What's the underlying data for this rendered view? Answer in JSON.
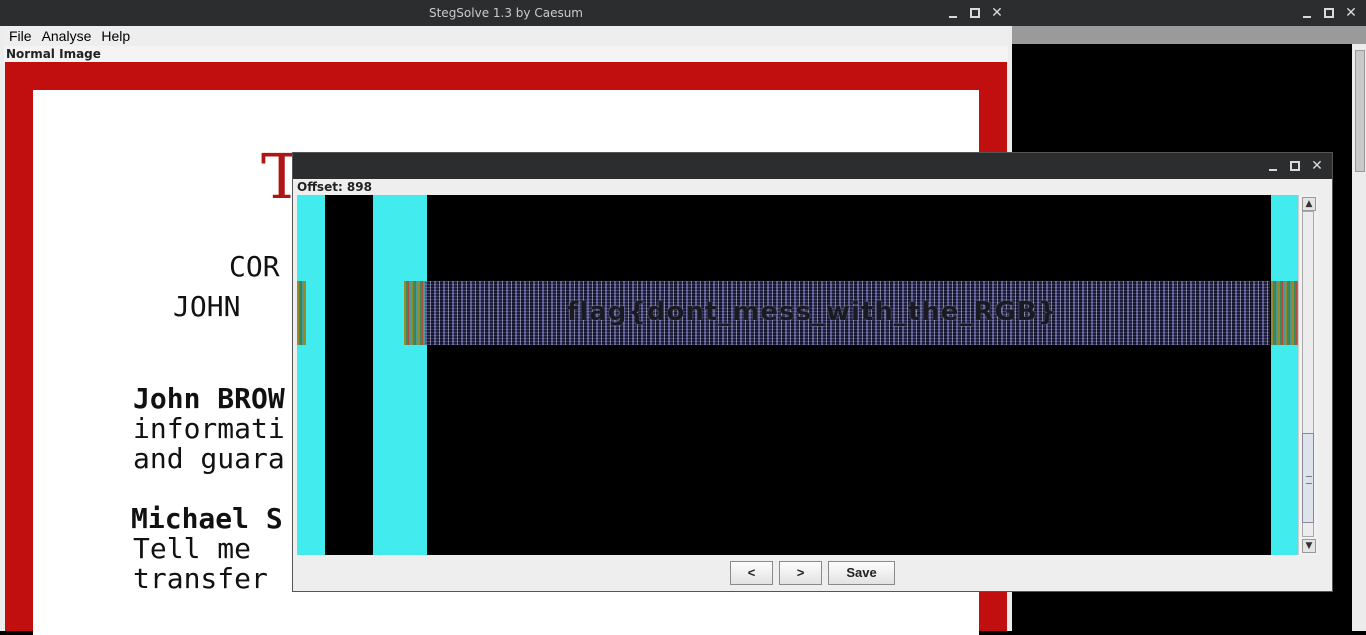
{
  "main_window": {
    "title": "StegSolve 1.3 by Caesum",
    "menu": [
      "File",
      "Analyse",
      "Help"
    ],
    "view_label": "Normal Image",
    "document": {
      "heading_letter": "T",
      "lines": [
        "COR",
        "JOHN",
        "John BROW",
        "informati",
        "and guara",
        "Michael S",
        "Tell me",
        "transfer"
      ]
    }
  },
  "dialog": {
    "offset_label": "Offset: 898",
    "hidden_text": "flag{dont_mess_with_the_RGB}",
    "buttons": {
      "prev": "<",
      "next": ">",
      "save": "Save"
    }
  },
  "window_controls": {
    "minimize": "minimize-icon",
    "maximize": "maximize-icon",
    "close": "close-icon",
    "close_glyph": "✕"
  },
  "colors": {
    "accent_red": "#c10f0f",
    "cyan": "#42ecee",
    "titlebar": "#2b2d2f"
  }
}
